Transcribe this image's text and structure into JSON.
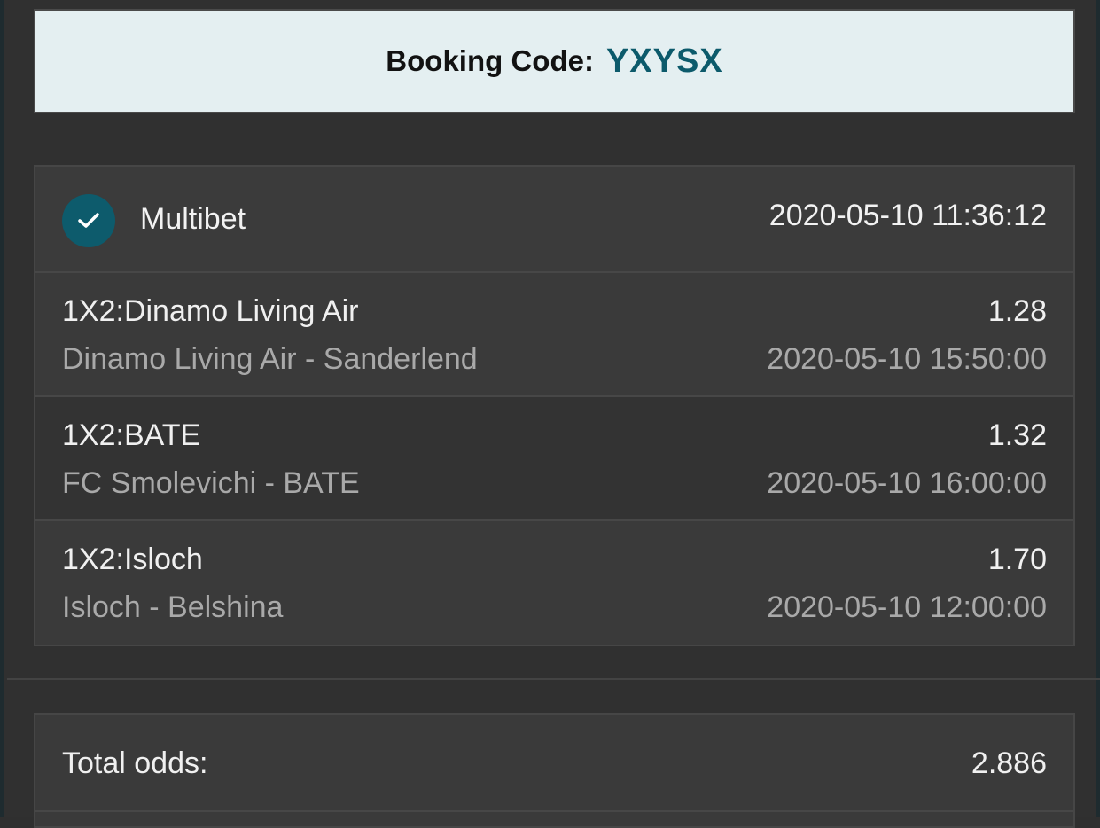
{
  "booking": {
    "label": "Booking Code:",
    "code": "YXYSX"
  },
  "bet": {
    "type": "Multibet",
    "placed_at": "2020-05-10 11:36:12",
    "status_icon": "check-icon",
    "selections": [
      {
        "market": "1X2:Dinamo Living Air",
        "odds": "1.28",
        "match": "Dinamo Living Air - Sanderlend",
        "kickoff": "2020-05-10 15:50:00"
      },
      {
        "market": "1X2:BATE",
        "odds": "1.32",
        "match": "FC Smolevichi - BATE",
        "kickoff": "2020-05-10 16:00:00"
      },
      {
        "market": "1X2:Isloch",
        "odds": "1.70",
        "match": "Isloch - Belshina",
        "kickoff": "2020-05-10 12:00:00"
      }
    ]
  },
  "totals": {
    "odds_label": "Total odds:",
    "odds_value": "2.886"
  },
  "colors": {
    "accent": "#0c5a6b",
    "banner_bg": "#e4eff1",
    "panel_bg": "#3a3a3a",
    "page_bg": "#303030"
  }
}
